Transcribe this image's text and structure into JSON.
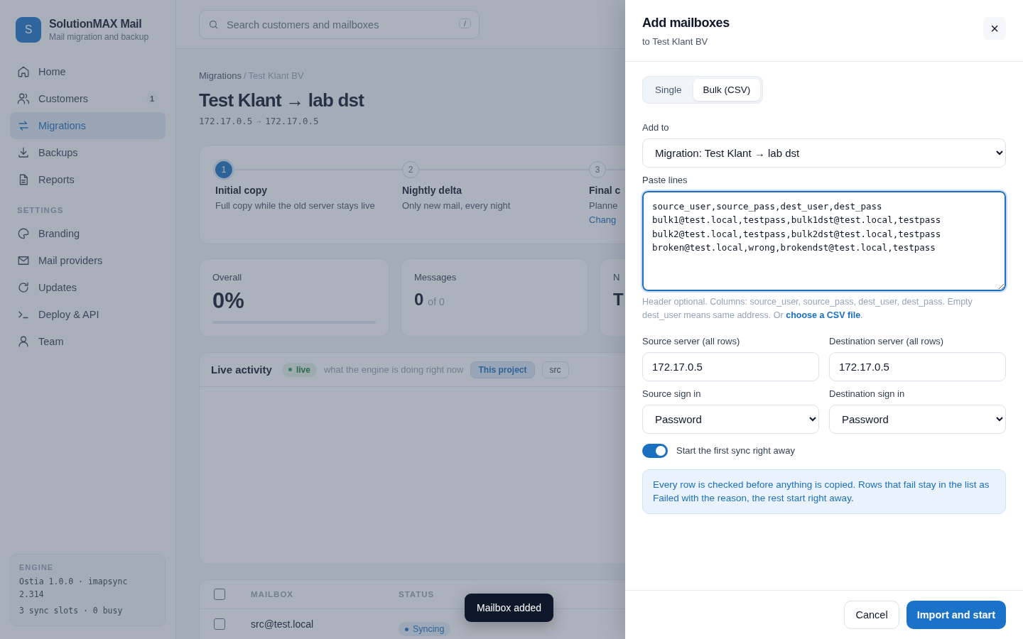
{
  "brand": {
    "logo_letter": "S",
    "name": "SolutionMAX Mail",
    "tagline": "Mail migration and backup"
  },
  "nav": [
    {
      "label": "Home",
      "selected": false
    },
    {
      "label": "Customers",
      "badge": "1",
      "selected": false
    },
    {
      "label": "Migrations",
      "selected": true
    },
    {
      "label": "Backups",
      "selected": false
    },
    {
      "label": "Reports",
      "selected": false
    }
  ],
  "settings": {
    "title": "SETTINGS",
    "items": [
      {
        "label": "Branding",
        "selected": false
      },
      {
        "label": "Mail providers",
        "selected": false
      },
      {
        "label": "Updates",
        "selected": false
      },
      {
        "label": "Deploy & API",
        "selected": false
      },
      {
        "label": "Team",
        "selected": false
      }
    ]
  },
  "engine": {
    "title": "ENGINE",
    "version": "Ostia 1.0.0 · imapsync 2.314",
    "slots": "3 sync slots · 0 busy"
  },
  "search": {
    "placeholder": "Search customers and mailboxes",
    "shortcut": "/"
  },
  "breadcrumb": {
    "parent": "Migrations",
    "separator": "/",
    "current": "Test Klant BV"
  },
  "page_title": "Test Klant → lab dst",
  "route": {
    "source": "172.17.0.5",
    "arrow": "→",
    "dest": "172.17.0.5"
  },
  "steps": [
    {
      "number": "1",
      "title": "Initial copy",
      "description": "Full copy while the old server stays live",
      "active": true
    },
    {
      "number": "2",
      "title": "Nightly delta",
      "description": "Only new mail, every night",
      "active": false
    },
    {
      "number": "3",
      "title": "Final c",
      "description": "Planne",
      "link": "Chang",
      "active": false
    }
  ],
  "stats": [
    {
      "kind": "progress",
      "label": "Overall",
      "value": "0%",
      "level": 0
    },
    {
      "kind": "count",
      "label": "Messages",
      "value": "0",
      "of": "of 0"
    },
    {
      "kind": "count",
      "label": "N",
      "value": "T"
    }
  ],
  "activity": {
    "title": "Live activity",
    "badge": "live",
    "subtitle": "what the engine is doing right now",
    "filters": [
      {
        "label": "This project",
        "selected": true
      },
      {
        "label": "src",
        "selected": false
      }
    ]
  },
  "table": {
    "columns": [
      "MAILBOX",
      "STATUS"
    ],
    "all_checked": false,
    "rows": [
      {
        "mailbox": "src@test.local",
        "status": "Syncing",
        "checked": false
      }
    ]
  },
  "toast": "Mailbox added",
  "drawer": {
    "title": "Add mailboxes",
    "subtitle": "to Test Klant BV",
    "close": "×",
    "tabs": [
      {
        "label": "Single",
        "selected": false
      },
      {
        "label": "Bulk (CSV)",
        "selected": true
      }
    ],
    "add_to": {
      "label": "Add to",
      "value": "Migration: Test Klant → lab dst"
    },
    "paste": {
      "label": "Paste lines",
      "value": "source_user,source_pass,dest_user,dest_pass\nbulk1@test.local,testpass,bulk1dst@test.local,testpass\nbulk2@test.local,testpass,bulk2dst@test.local,testpass\nbroken@test.local,wrong,brokendst@test.local,testpass"
    },
    "hint": {
      "text": "Header optional. Columns: source_user, source_pass, dest_user, dest_pass. Empty dest_user means same address. Or ",
      "link": "choose a CSV file",
      "after": "."
    },
    "source_server": {
      "label": "Source server (all rows)",
      "value": "172.17.0.5"
    },
    "dest_server": {
      "label": "Destination server (all rows)",
      "value": "172.17.0.5"
    },
    "source_signin": {
      "label": "Source sign in",
      "value": "Password"
    },
    "dest_signin": {
      "label": "Destination sign in",
      "value": "Password"
    },
    "start_now": {
      "label": "Start the first sync right away",
      "on": true
    },
    "info": "Every row is checked before anything is copied. Rows that fail stay in the list as Failed with the reason, the rest start right away.",
    "buttons": {
      "cancel": "Cancel",
      "submit": "Import and start"
    }
  }
}
